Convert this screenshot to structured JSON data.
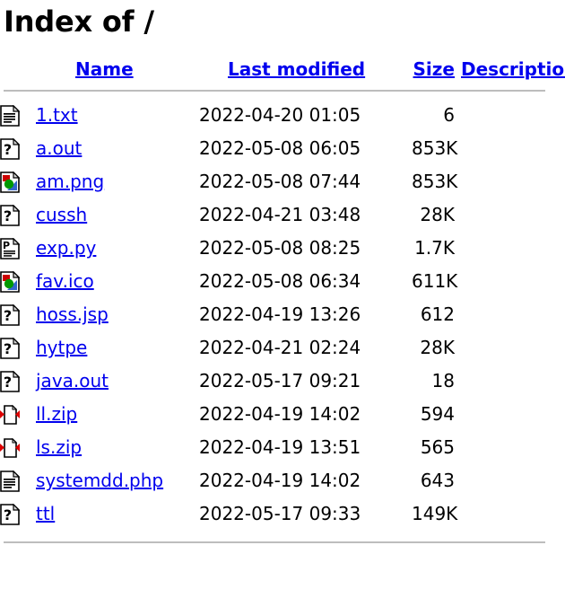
{
  "page": {
    "title": "Index of /"
  },
  "columns": {
    "icon": "",
    "name": "Name",
    "last_modified": "Last modified",
    "size": "Size",
    "description": "Description"
  },
  "colors": {
    "link": "#0000ee",
    "rule": "#bdbdbd",
    "text": "#000000",
    "icon_red": "#cc0000",
    "icon_green": "#009900",
    "icon_blue": "#3366cc"
  },
  "rows": [
    {
      "icon": "text-file-icon",
      "name": "1.txt",
      "last_modified": "2022-04-20 01:05",
      "size": "6",
      "description": ""
    },
    {
      "icon": "unknown-file-icon",
      "name": "a.out",
      "last_modified": "2022-05-08 06:05",
      "size": "853K",
      "description": ""
    },
    {
      "icon": "image-file-icon",
      "name": "am.png",
      "last_modified": "2022-05-08 07:44",
      "size": "853K",
      "description": ""
    },
    {
      "icon": "unknown-file-icon",
      "name": "cussh",
      "last_modified": "2022-04-21 03:48",
      "size": "28K",
      "description": ""
    },
    {
      "icon": "script-file-icon",
      "name": "exp.py",
      "last_modified": "2022-05-08 08:25",
      "size": "1.7K",
      "description": ""
    },
    {
      "icon": "image-file-icon",
      "name": "fav.ico",
      "last_modified": "2022-05-08 06:34",
      "size": "611K",
      "description": ""
    },
    {
      "icon": "unknown-file-icon",
      "name": "hoss.jsp",
      "last_modified": "2022-04-19 13:26",
      "size": "612",
      "description": ""
    },
    {
      "icon": "unknown-file-icon",
      "name": "hytpe",
      "last_modified": "2022-04-21 02:24",
      "size": "28K",
      "description": ""
    },
    {
      "icon": "unknown-file-icon",
      "name": "java.out",
      "last_modified": "2022-05-17 09:21",
      "size": "18",
      "description": ""
    },
    {
      "icon": "compressed-file-icon",
      "name": "ll.zip",
      "last_modified": "2022-04-19 14:02",
      "size": "594",
      "description": ""
    },
    {
      "icon": "compressed-file-icon",
      "name": "ls.zip",
      "last_modified": "2022-04-19 13:51",
      "size": "565",
      "description": ""
    },
    {
      "icon": "text-file-icon",
      "name": "systemdd.php",
      "last_modified": "2022-04-19 14:02",
      "size": "643",
      "description": ""
    },
    {
      "icon": "unknown-file-icon",
      "name": "ttl",
      "last_modified": "2022-05-17 09:33",
      "size": "149K",
      "description": ""
    }
  ]
}
